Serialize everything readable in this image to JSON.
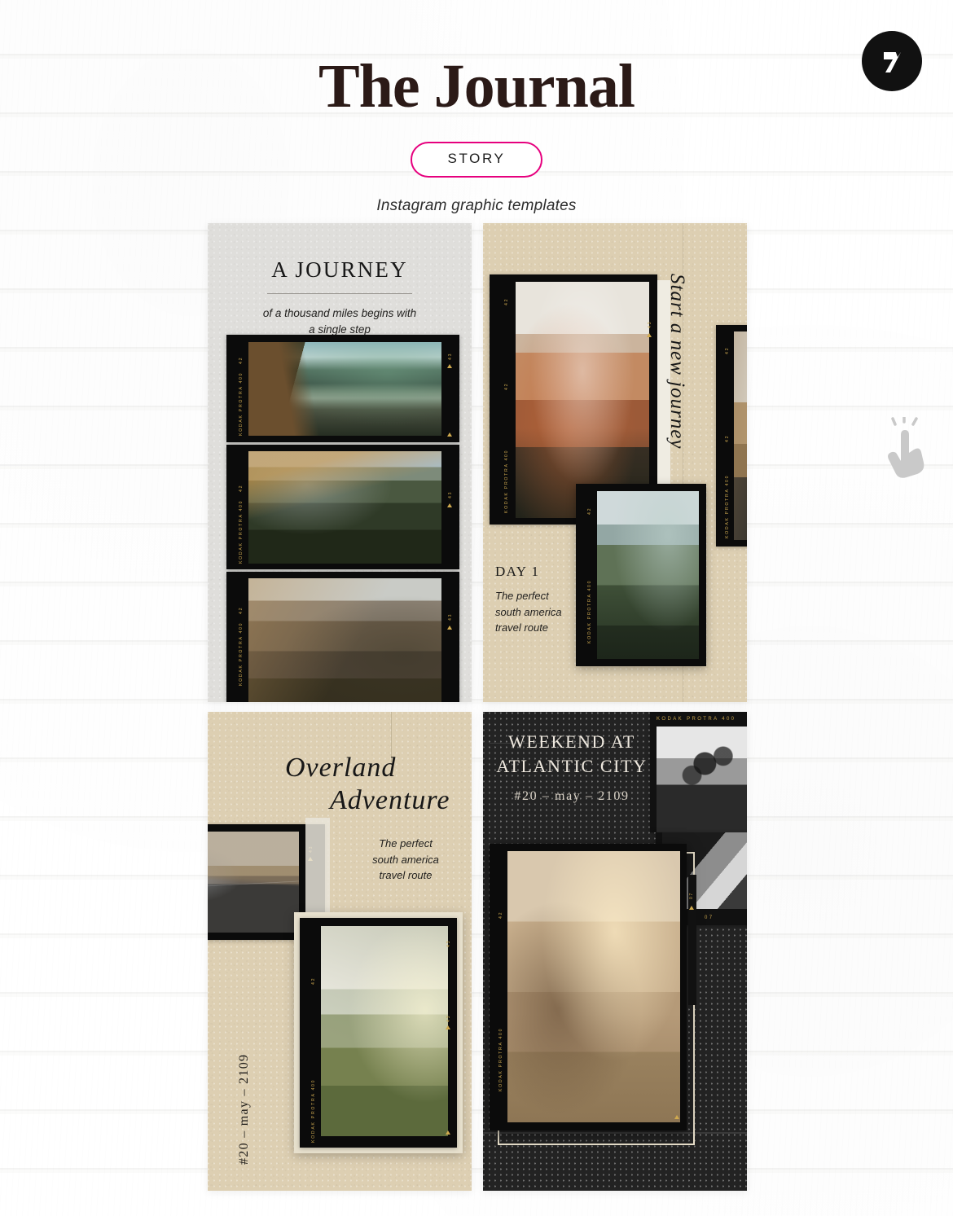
{
  "header": {
    "title": "The Journal",
    "badge_label": "STORY",
    "subtitle": "Instagram graphic templates"
  },
  "brand": {
    "logo_name": "zeroseven-logo",
    "circle_color": "#111111",
    "glyph_color": "#ffffff"
  },
  "cursor": {
    "icon_name": "pointing-hand-cursor",
    "color": "#c9c9c9"
  },
  "theme": {
    "accent_pink": "#e6007e",
    "title_brown": "#2b1a17",
    "paper_gray": "#dfdedb",
    "paper_beige": "#ddcfb2",
    "paper_dark": "#232323",
    "film_black": "#0b0b0b",
    "film_gold": "#c8a44e"
  },
  "film_label": {
    "brand": "KODAK PROTRA 400",
    "frame_number": "42",
    "frame_number_alt": "07",
    "frame_code": "43"
  },
  "templates": [
    {
      "id": "template-a-journey",
      "paper": "gray",
      "title": "A JOURNEY",
      "body": "of a thousand miles begins with\na single step",
      "body_line1": "of a thousand miles begins with",
      "body_line2": "a single step",
      "photos": [
        "alpine lake road",
        "autumn mountain forest",
        "mountain ridge switchback"
      ]
    },
    {
      "id": "template-day-1",
      "paper": "beige",
      "script_vertical": "Start a new journey",
      "day_label": "DAY 1",
      "body_line1": "The perfect",
      "body_line2": "south america",
      "body_line3": "travel route",
      "photos": [
        "aerial red canyon",
        "coastal cliff road",
        "desert highway"
      ]
    },
    {
      "id": "template-overland-adventure",
      "paper": "beige",
      "script_line1": "Overland",
      "script_line2": "Adventure",
      "body_line1": "The perfect",
      "body_line2": "south america",
      "body_line3": "travel route",
      "date": "#20 – may – 2109",
      "photos": [
        "desert road with bird",
        "green alpine valley"
      ]
    },
    {
      "id": "template-weekend-atlantic-city",
      "paper": "dark",
      "title_line1": "WEEKEND AT",
      "title_line2": "ATLANTIC CITY",
      "date": "#20 – may – 2109",
      "photos": [
        "black and white tree",
        "black and white hand detail",
        "sepia cafe portrait"
      ]
    }
  ]
}
